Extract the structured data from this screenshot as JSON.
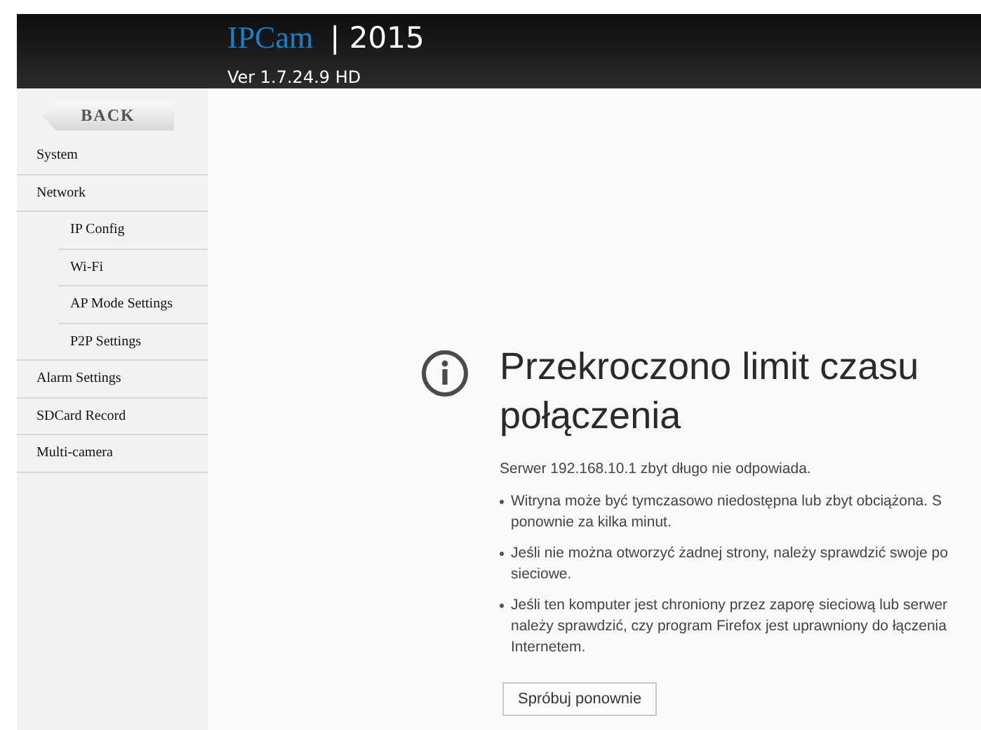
{
  "header": {
    "logo": "IPCam",
    "year": "| 2015",
    "version": "Ver  1.7.24.9 HD"
  },
  "sidebar": {
    "back_button": "BACK",
    "items": [
      {
        "label": "System"
      },
      {
        "label": "Network",
        "children": [
          {
            "label": "IP Config"
          },
          {
            "label": "Wi-Fi"
          },
          {
            "label": "AP Mode Settings"
          },
          {
            "label": "P2P Settings"
          }
        ]
      },
      {
        "label": "Alarm Settings"
      },
      {
        "label": "SDCard Record"
      },
      {
        "label": "Multi-camera"
      }
    ]
  },
  "error": {
    "title": "Przekroczono limit czasu połączenia",
    "message": "Serwer 192.168.10.1 zbyt długo nie odpowiada.",
    "bullets": [
      [
        "Witryna może być tymczasowo niedostępna lub zbyt obciążona. S",
        "ponownie za kilka minut."
      ],
      [
        "Jeśli nie można otworzyć żadnej strony, należy sprawdzić swoje po",
        "sieciowe."
      ],
      [
        "Jeśli ten komputer jest chroniony przez zaporę sieciową lub serwer",
        "należy sprawdzić, czy program Firefox jest uprawniony do łączenia",
        "Internetem."
      ]
    ],
    "retry_button": "Spróbuj ponownie"
  }
}
